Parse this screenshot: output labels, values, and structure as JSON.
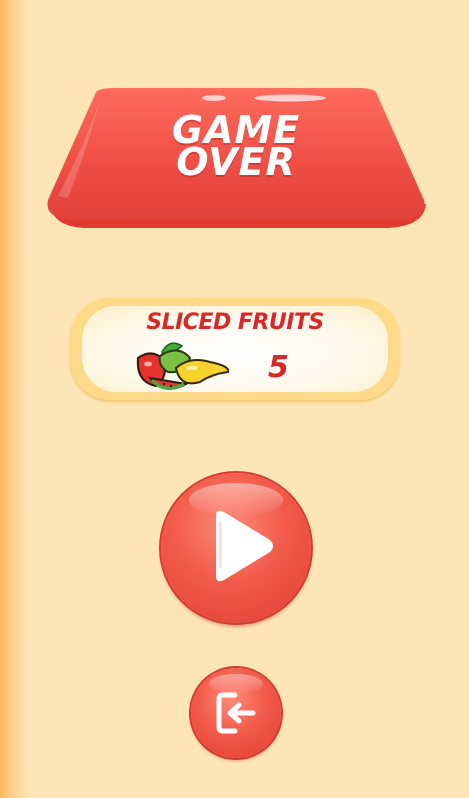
{
  "banner": {
    "line1": "GAME",
    "line2": "OVER"
  },
  "score_panel": {
    "label": "SLICED FRUITS",
    "value": "5",
    "icon": "fruit-bundle-icon"
  },
  "buttons": {
    "play": {
      "icon": "play-icon"
    },
    "exit": {
      "icon": "exit-icon"
    }
  },
  "colors": {
    "background": "#fde5b5",
    "banner_red": "#ee4d44",
    "accent_red": "#d62a2a",
    "button_red": "#f15a4a",
    "panel_border": "#fdd98a",
    "text_white": "#ffffff"
  }
}
